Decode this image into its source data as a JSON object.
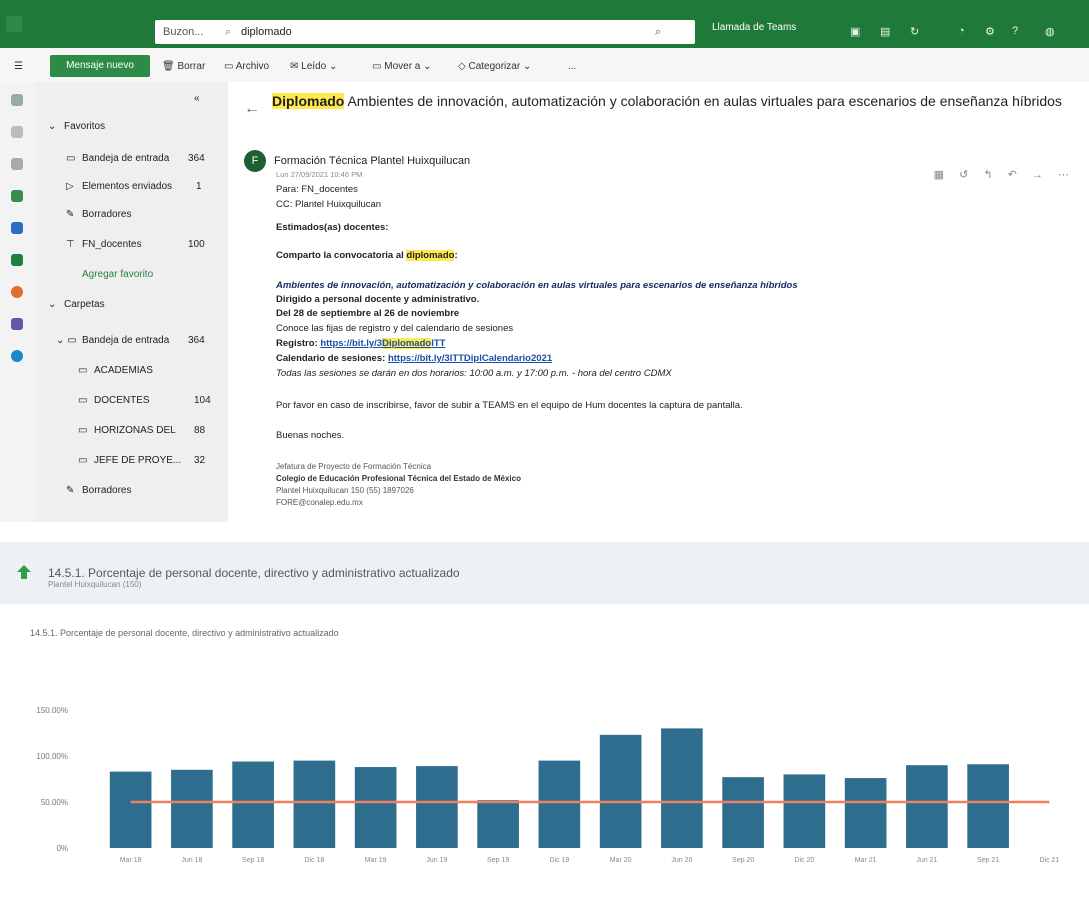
{
  "topbar": {
    "search_scope": "Buzon... ",
    "search_query": "diplomado",
    "meeting_label": "Llamada de Teams",
    "icons": [
      "apps-icon",
      "search-icon",
      "teams-icon",
      "calendar-icon",
      "share-icon",
      "bell-icon",
      "gear-icon",
      "help-icon",
      "account-icon"
    ]
  },
  "toolbar": {
    "new_mail": "Mensaje nuevo",
    "delete": "Borrar",
    "archive": "Archivo",
    "read": "Leído",
    "move_to": "Mover a",
    "categorize": "Categorizar",
    "more": "..."
  },
  "folders": {
    "favorites": "Favoritos",
    "items": [
      {
        "label": "Bandeja de entrada",
        "count": "364"
      },
      {
        "label": "Elementos enviados",
        "count": "1"
      },
      {
        "label": "Borradores",
        "count": ""
      },
      {
        "label": "FN_docentes",
        "count": "100"
      }
    ],
    "add_favorite": "Agregar favorito",
    "folders_header": "Carpetas",
    "folder_items": [
      {
        "label": "Bandeja de entrada",
        "count": "364"
      },
      {
        "label": "ACADEMIAS",
        "count": ""
      },
      {
        "label": "DOCENTES",
        "count": "104"
      },
      {
        "label": "HORIZONAS DEL",
        "count": "88"
      },
      {
        "label": "JEFE DE PROYE...",
        "count": "32"
      }
    ],
    "drafts": "Borradores"
  },
  "message": {
    "subject_highlight": "Diplomado",
    "subject_rest": " Ambientes de innovación, automatización y colaboración en aulas virtuales para escenarios de enseñanza híbridos",
    "avatar": "F",
    "sender": "Formación Técnica Plantel Huixquilucan",
    "date": "Lun 27/09/2021 10:46 PM",
    "to": "Para:  FN_docentes",
    "cc": "CC:  Plantel Huixquilucan",
    "greeting": "Estimados(as) docentes:",
    "share_prefix": "Comparto la convocatoria al ",
    "share_hl": "diplomado",
    "share_suffix": ":",
    "course_title": "Ambientes de innovación, automatización y colaboración en aulas virtuales para escenarios de enseñanza híbridos",
    "directed": "Dirigido a personal docente y administrativo.",
    "dates": "Del 28 de septiembre al 26 de noviembre",
    "know": "Conoce las fijas de registro y del calendario de sesiones",
    "registro_label": "Registro: ",
    "registro_url_pre": "https://bit.ly/3",
    "registro_hl": "Diplomado",
    "registro_url_post": "ITT",
    "cal_label": "Calendario de sesiones: ",
    "cal_url": "https://bit.ly/3ITTDiplCalendario2021",
    "sessions": "Todas las sesiones se darán en dos horarios: 10:00 a.m. y 17:00 p.m. - hora del centro CDMX",
    "favor": "Por favor en caso de inscribirse, favor de subir a TEAMS en el equipo de Hum docentes la captura de pantalla.",
    "bye": "Buenas noches.",
    "sig1": "Jefatura de Proyecto de Formación Técnica",
    "sig2": "Colegio de Educación Profesional Técnica del Estado de México",
    "sig3": "Plantel Huixquilucan 150 (55) 1897026",
    "sig4": "FORE@conalep.edu.mx",
    "actions": "▦ ↺ ↰ ↶ → ⋯"
  },
  "section": {
    "title": "14.5.1. Porcentaje de personal docente, directivo y administrativo actualizado",
    "subtitle": "Plantel Huixquilucan (150)",
    "chart_label": "14.5.1. Porcentaje de personal docente, directivo y administrativo actualizado"
  },
  "chart_data": {
    "type": "bar",
    "title": "14.5.1. Porcentaje de personal docente, directivo y administrativo actualizado",
    "categories": [
      "Mar 18",
      "Jun 18",
      "Sep 18",
      "Dic 18",
      "Mar 19",
      "Jun 19",
      "Sep 19",
      "Dic 19",
      "Mar 20",
      "Jun 20",
      "Sep 20",
      "Dic 20",
      "Mar 21",
      "Jun 21",
      "Sep 21",
      "Dic 21"
    ],
    "series": [
      {
        "type": "bar",
        "values": [
          83,
          85,
          94,
          95,
          88,
          89,
          52,
          95,
          123,
          130,
          77,
          80,
          76,
          90,
          91,
          null
        ]
      },
      {
        "type": "line",
        "values": [
          50,
          50,
          50,
          50,
          50,
          50,
          50,
          50,
          50,
          50,
          50,
          50,
          50,
          50,
          50,
          50
        ]
      }
    ],
    "ylim": [
      0,
      200
    ],
    "yticks": [
      "0%",
      "50.00%",
      "100.00%",
      "150.00%"
    ],
    "colors": {
      "bar": "#2e6d8e",
      "line": "#f08060"
    },
    "grid": false
  }
}
